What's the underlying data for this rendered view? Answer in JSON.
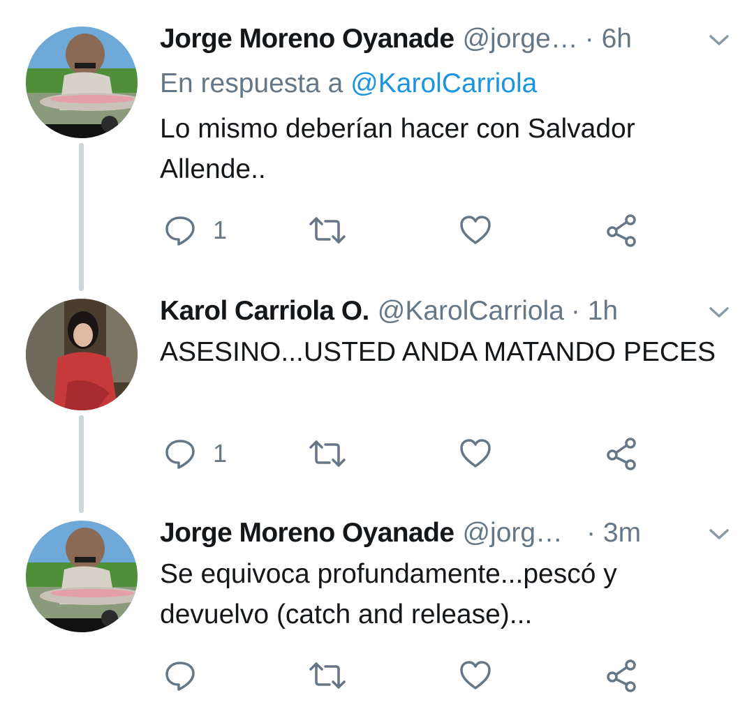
{
  "tweets": [
    {
      "name": "Jorge Moreno Oyanade",
      "handle": "@jorge…",
      "time": "· 6h",
      "reply_prefix": "En respuesta a ",
      "reply_mention": "@KarolCarriola",
      "text": "Lo mismo deberían hacer con Salvador Allende..",
      "reply_count": "1",
      "avatar": "fisherman-holding-trout-photo"
    },
    {
      "name": "Karol Carriola O.",
      "handle": "@KarolCarriola",
      "time": "· 1h",
      "text": "ASESINO...USTED ANDA MATANDO PECES",
      "reply_count": "1",
      "avatar": "woman-in-red-jacket-photo"
    },
    {
      "name": "Jorge Moreno Oyanade",
      "handle": "@jorg…",
      "time": "· 3m",
      "text": "Se equivoca profundamente...pescó y devuelvo (catch and release)...",
      "reply_count": "",
      "avatar": "fisherman-holding-trout-photo"
    }
  ],
  "icons": {
    "reply": "reply-icon",
    "retweet": "retweet-icon",
    "like": "like-icon",
    "share": "share-icon",
    "menu": "chevron-down-icon"
  },
  "colors": {
    "text": "#14171a",
    "secondary": "#657786",
    "link": "#1b95e0",
    "thread_line": "#ccd6dd"
  }
}
